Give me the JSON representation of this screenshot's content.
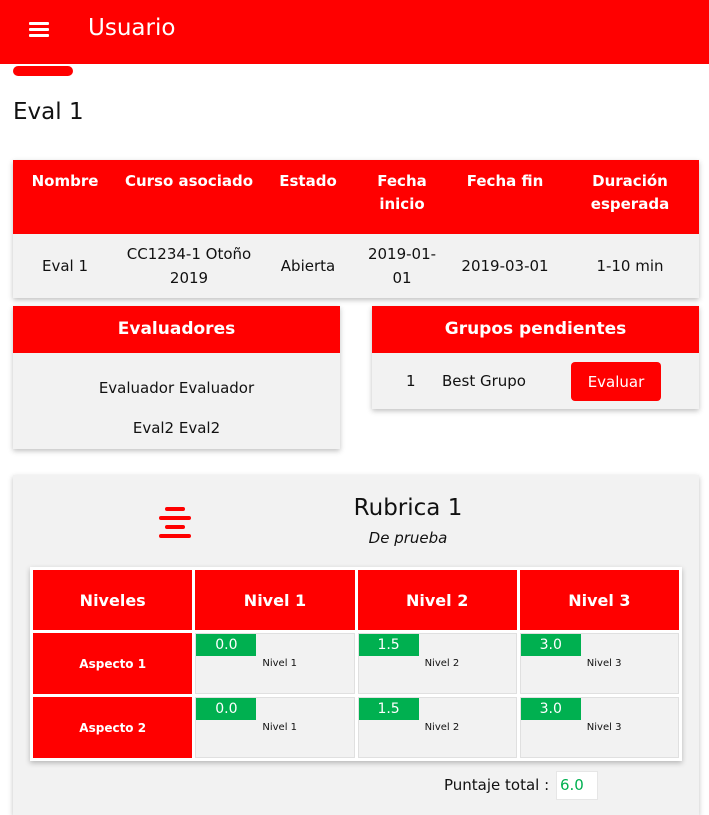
{
  "header": {
    "title": "Usuario"
  },
  "page": {
    "title": "Eval 1"
  },
  "info_table": {
    "columns": [
      "Nombre",
      "Curso asociado",
      "Estado",
      "Fecha inicio",
      "Fecha fin",
      "Duración esperada"
    ],
    "row": [
      "Eval 1",
      "CC1234-1 Otoño 2019",
      "Abierta",
      "2019-01-01",
      "2019-03-01",
      "1-10 min"
    ]
  },
  "evaluadores": {
    "title": "Evaluadores",
    "items": [
      "Evaluador Evaluador",
      "Eval2 Eval2"
    ]
  },
  "grupos": {
    "title": "Grupos pendientes",
    "items": [
      {
        "number": "1",
        "name": "Best Grupo",
        "action": "Evaluar"
      }
    ]
  },
  "rubrica": {
    "title": "Rubrica 1",
    "subtitle": "De prueba",
    "headers": [
      "Niveles",
      "Nivel 1",
      "Nivel 2",
      "Nivel 3"
    ],
    "rows": [
      {
        "aspect": "Aspecto 1",
        "cells": [
          {
            "score": "0.0",
            "label": "Nivel 1"
          },
          {
            "score": "1.5",
            "label": "Nivel 2"
          },
          {
            "score": "3.0",
            "label": "Nivel 3"
          }
        ]
      },
      {
        "aspect": "Aspecto 2",
        "cells": [
          {
            "score": "0.0",
            "label": "Nivel 1"
          },
          {
            "score": "1.5",
            "label": "Nivel 2"
          },
          {
            "score": "3.0",
            "label": "Nivel 3"
          }
        ]
      }
    ],
    "total_label": "Puntaje total :",
    "total_value": "6.0"
  },
  "colors": {
    "primary": "#ff0000",
    "score": "#00b050",
    "card_bg": "#f2f2f2"
  }
}
